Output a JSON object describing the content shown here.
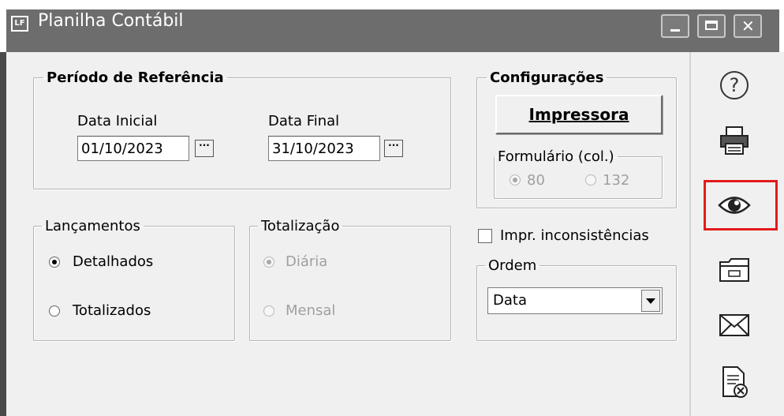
{
  "window": {
    "title": "Planilha Contábil",
    "app_icon": "LF"
  },
  "periodo": {
    "legend": "Período de Referência",
    "data_inicial_label": "Data Inicial",
    "data_inicial_value": "01/10/2023",
    "data_final_label": "Data Final",
    "data_final_value": "31/10/2023",
    "picker_label": "···"
  },
  "configuracoes": {
    "legend": "Configurações",
    "impressora_button": "Impressora",
    "formulario": {
      "legend": "Formulário (col.)",
      "options": [
        "80",
        "132"
      ],
      "selected": "80"
    }
  },
  "lancamentos": {
    "legend": "Lançamentos",
    "options": [
      "Detalhados",
      "Totalizados"
    ],
    "selected": "Detalhados"
  },
  "totalizacao": {
    "legend": "Totalização",
    "options": [
      "Diária",
      "Mensal"
    ],
    "selected": "Diária"
  },
  "inconsistencias": {
    "label": "Impr. inconsistências",
    "checked": false
  },
  "ordem": {
    "legend": "Ordem",
    "selected": "Data"
  },
  "side_toolbar": {
    "icons": [
      "help-icon",
      "printer-icon",
      "eye-icon",
      "folder-icon",
      "mail-icon",
      "document-cancel-icon"
    ],
    "highlight_color": "#e21b1b"
  }
}
